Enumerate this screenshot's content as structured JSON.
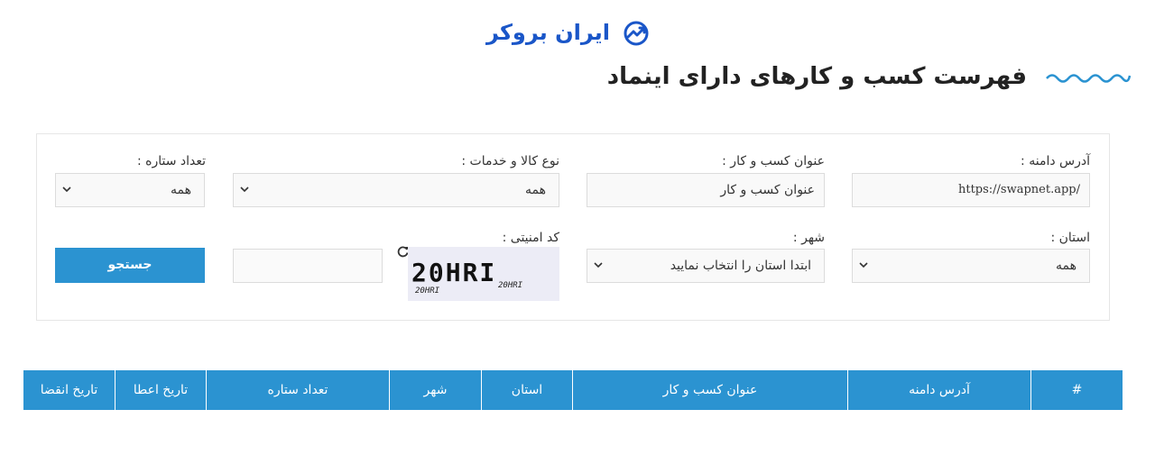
{
  "brand": {
    "logo_text": "ایران بروکر",
    "accent": "#1a56c8"
  },
  "page": {
    "title": "فهرست کسب و کارهای دارای اینماد",
    "wave_color": "#2b93d1"
  },
  "filters": {
    "domain": {
      "label": "آدرس دامنه :",
      "value": "https://swapnet.app/"
    },
    "business_title": {
      "label": "عنوان کسب و کار :",
      "placeholder": "عنوان کسب و کار"
    },
    "goods_type": {
      "label": "نوع کالا و خدمات :",
      "selected": "همه"
    },
    "stars": {
      "label": "تعداد ستاره :",
      "selected": "همه"
    },
    "province": {
      "label": "استان :",
      "selected": "همه"
    },
    "city": {
      "label": "شهر :",
      "selected": "ابتدا استان را انتخاب نمایید"
    },
    "captcha": {
      "label": "کد امنیتی :",
      "image_text": "20HRI",
      "noise_a": "20HRI",
      "noise_b": "20HRI",
      "input_value": ""
    },
    "search_button": "جستجو"
  },
  "table": {
    "header_color": "#2b93d1",
    "columns": [
      "#",
      "آدرس دامنه",
      "عنوان کسب و کار",
      "استان",
      "شهر",
      "تعداد ستاره",
      "تاریخ اعطا",
      "تاریخ انقضا"
    ]
  }
}
